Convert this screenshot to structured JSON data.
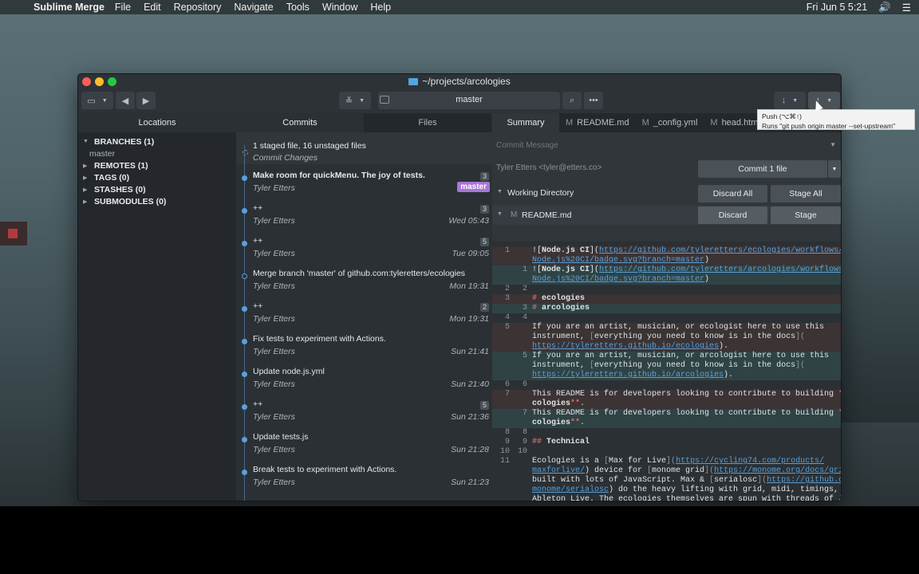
{
  "menubar": {
    "app_name": "Sublime Merge",
    "items": [
      "File",
      "Edit",
      "Repository",
      "Navigate",
      "Tools",
      "Window",
      "Help"
    ],
    "clock": "Fri Jun 5  5:21"
  },
  "window": {
    "title": "~/projects/arcologies",
    "branch_selector": "master"
  },
  "locations": {
    "header": "Locations",
    "branches_label": "BRANCHES (1)",
    "branch_master": "master",
    "remotes_label": "REMOTES (1)",
    "tags_label": "TAGS (0)",
    "stashes_label": "STASHES (0)",
    "submodules_label": "SUBMODULES (0)"
  },
  "commits_panel": {
    "tab_commits": "Commits",
    "tab_files": "Files",
    "staged_summary": "1 staged file, 16 unstaged files",
    "staged_action": "Commit Changes",
    "rows": [
      {
        "message": "Make room for quickMenu. The joy of tests.",
        "author": "Tyler Etters",
        "date": "",
        "count": "3",
        "badge": "master",
        "bold": true
      },
      {
        "message": "++",
        "author": "Tyler Etters",
        "date": "Wed 05:43",
        "count": "3",
        "badge": "",
        "bold": false
      },
      {
        "message": "++",
        "author": "Tyler Etters",
        "date": "Tue 09:05",
        "count": "5",
        "badge": "",
        "bold": false
      },
      {
        "message": "Merge branch 'master' of github.com:tyleretters/ecologies",
        "author": "Tyler Etters",
        "date": "Mon 19:31",
        "count": "",
        "badge": "",
        "bold": false
      },
      {
        "message": "++",
        "author": "Tyler Etters",
        "date": "Mon 19:31",
        "count": "2",
        "badge": "",
        "bold": false
      },
      {
        "message": "Fix tests to experiment with Actions.",
        "author": "Tyler Etters",
        "date": "Sun 21:41",
        "count": "",
        "badge": "",
        "bold": false
      },
      {
        "message": "Update node.js.yml",
        "author": "Tyler Etters",
        "date": "Sun 21:40",
        "count": "",
        "badge": "",
        "bold": false
      },
      {
        "message": "++",
        "author": "Tyler Etters",
        "date": "Sun 21:36",
        "count": "5",
        "badge": "",
        "bold": false
      },
      {
        "message": "Update tests.js",
        "author": "Tyler Etters",
        "date": "Sun 21:28",
        "count": "",
        "badge": "",
        "bold": false
      },
      {
        "message": "Break tests to experiment with Actions.",
        "author": "Tyler Etters",
        "date": "Sun 21:23",
        "count": "",
        "badge": "",
        "bold": false
      }
    ]
  },
  "summary": {
    "tab_summary": "Summary",
    "file_tabs": [
      "README.md",
      "_config.yml",
      "head.html"
    ],
    "commit_message_placeholder": "Commit Message",
    "author_line": "Tyler Etters <tyler@etters.co>",
    "commit_button": "Commit 1 file",
    "working_directory": "Working Directory",
    "discard_all": "Discard All",
    "stage_all": "Stage All",
    "file_name": "README.md",
    "discard": "Discard",
    "stage": "Stage"
  },
  "tooltip": {
    "line1": "Push (⌥⌘↑)",
    "line2": "Runs \"git push origin master --set-upstream\""
  },
  "colors": {
    "accent_blue": "#5aa0e0",
    "badge_purple": "#a876d6",
    "diff_del_bg": "#3b3334",
    "diff_add_bg": "#2f4345"
  }
}
